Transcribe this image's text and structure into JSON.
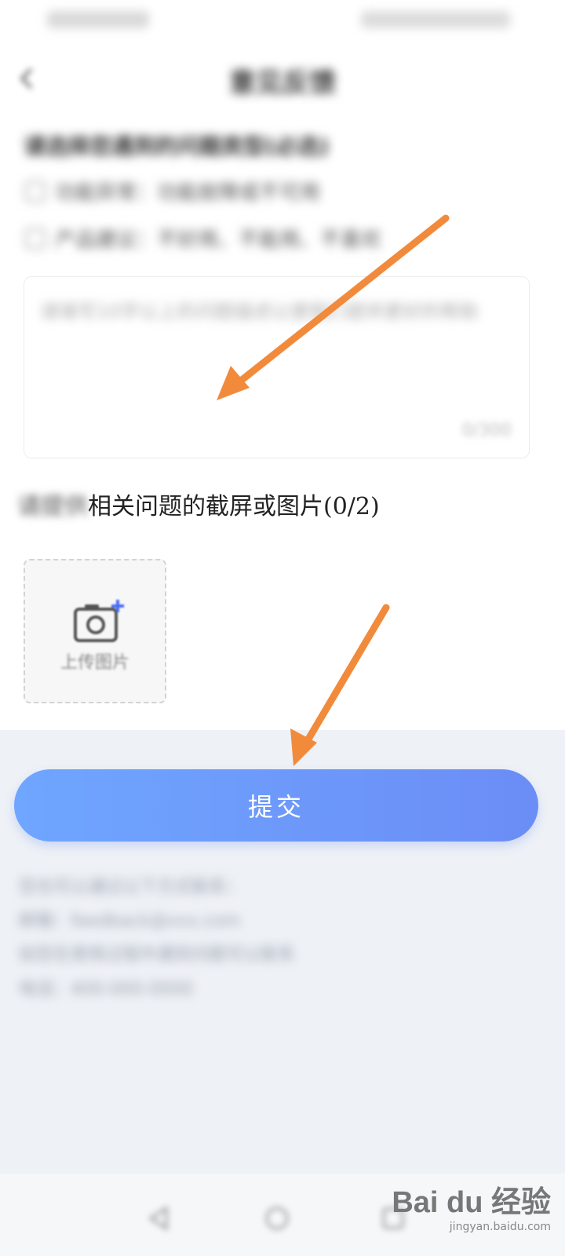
{
  "page": {
    "title": "意见反馈"
  },
  "question": {
    "title": "请选择您遇到的问题类型(必选)",
    "options": [
      "功能异常：功能故障或不可用",
      "产品建议：不好用、不能用、不喜欢"
    ]
  },
  "textarea": {
    "placeholder": "请填写10字以上的问题描述以便我们提供更好的帮助",
    "counter": "0/300"
  },
  "upload": {
    "title_blur": "请提供",
    "title_clear": "相关问题的截屏或图片(0/2)",
    "button_label": "上传图片"
  },
  "submit": {
    "label": "提交"
  },
  "contact": {
    "lines": [
      "您也可以通过以下方式联系：",
      "邮箱：feedback@xxx.com",
      "如您在使用过程中遇到问题可以联系",
      "电话：400-000-0000"
    ]
  },
  "watermark": {
    "logo": "Bai du 经验",
    "sub": "jingyan.baidu.com"
  },
  "colors": {
    "accent_start": "#6fa6ff",
    "accent_end": "#6b8df6",
    "arrow": "#f28a3c"
  },
  "icons": {
    "back": "chevron-left-icon",
    "upload": "camera-plus-icon",
    "nav": [
      "nav-back-icon",
      "nav-home-icon",
      "nav-recent-icon"
    ]
  }
}
